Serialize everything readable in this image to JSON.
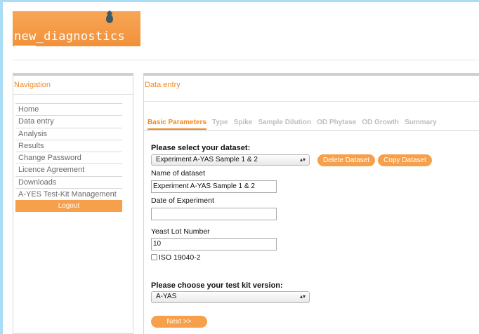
{
  "logo": {
    "text": "new_diagnostics"
  },
  "sidebar": {
    "title": "Navigation",
    "items": [
      {
        "label": "Home"
      },
      {
        "label": "Data entry"
      },
      {
        "label": "Analysis"
      },
      {
        "label": "Results"
      },
      {
        "label": "Change Password"
      },
      {
        "label": "Licence Agreement"
      },
      {
        "label": "Downloads"
      },
      {
        "label": "A-YES Test-Kit Management"
      }
    ],
    "logout_label": "Logout"
  },
  "main": {
    "title": "Data entry",
    "tabs": [
      {
        "label": "Basic Parameters",
        "active": true
      },
      {
        "label": "Type",
        "active": false
      },
      {
        "label": "Spike",
        "active": false
      },
      {
        "label": "Sample Dilution",
        "active": false
      },
      {
        "label": "OD Phytase",
        "active": false
      },
      {
        "label": "OD Growth",
        "active": false
      },
      {
        "label": "Summary",
        "active": false
      }
    ],
    "form": {
      "dataset_prompt": "Please select your dataset:",
      "dataset_selected": "Experiment A-YAS Sample 1 & 2",
      "delete_label": "Delete Dataset",
      "copy_label": "Copy Dataset",
      "name_label": "Name of dataset",
      "name_value": "Experiment A-YAS Sample 1 & 2",
      "date_label": "Date of Experiment",
      "date_value": "",
      "lot_label": "Yeast Lot Number",
      "lot_value": "10",
      "iso_label": "ISO 19040-2",
      "iso_checked": false,
      "kit_prompt": "Please choose your test kit version:",
      "kit_selected": "A-YAS",
      "next_label": "Next >>"
    }
  },
  "colors": {
    "accent": "#f08a24",
    "button": "#f7a04b",
    "edge": "#a9dcf5"
  }
}
